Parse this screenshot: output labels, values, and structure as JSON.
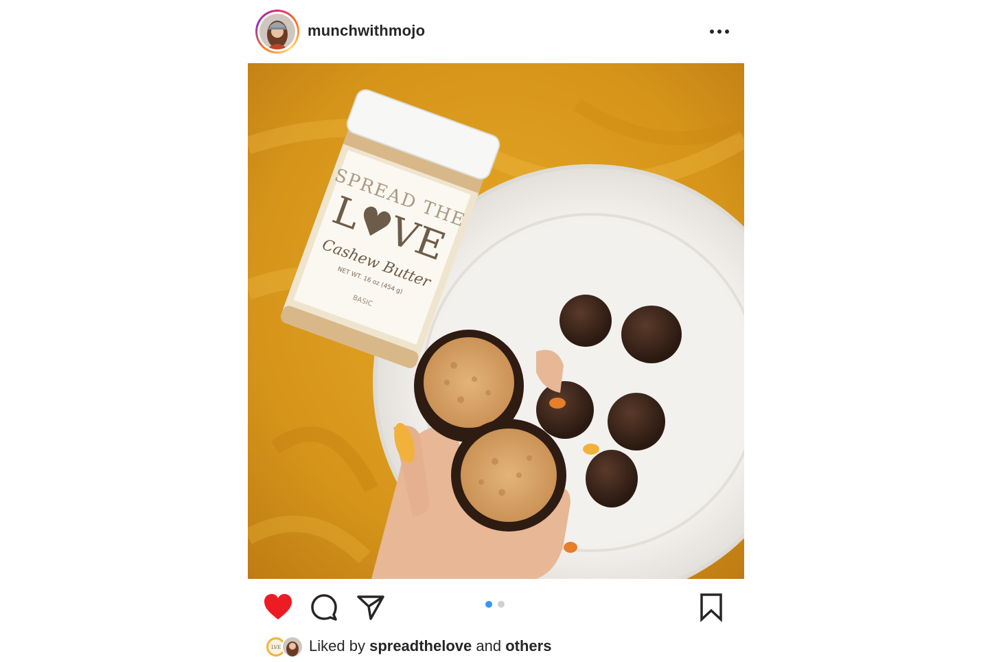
{
  "post": {
    "username": "munchwithmojo",
    "more_icon": "more-horizontal-icon",
    "photo": {
      "jar_brand": "SPREAD THE LOVE",
      "jar_product": "Cashew Butter",
      "jar_weight": "NET WT. 16 oz (454 g)",
      "jar_variant": "BASIC"
    },
    "carousel": {
      "count": 2,
      "active": 0
    },
    "actions": {
      "like_icon": "heart-filled-icon",
      "comment_icon": "comment-icon",
      "share_icon": "paper-plane-icon",
      "save_icon": "bookmark-icon"
    },
    "likes": {
      "prefix": "Liked by",
      "user": "spreadthelove",
      "conjunction": "and",
      "others": "others"
    }
  },
  "colors": {
    "like_red": "#ed1c24",
    "text": "#262626",
    "dot_active": "#3897f0",
    "dot_inactive": "#d0d0d0"
  }
}
